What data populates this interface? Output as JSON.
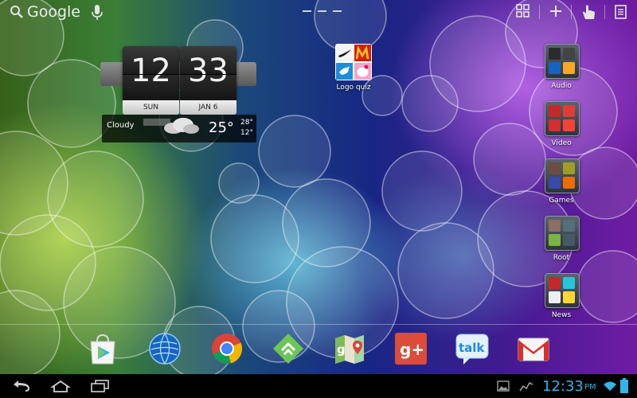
{
  "status_bar": {
    "search_label": "Google",
    "icons": [
      "search-icon",
      "mic-icon",
      "all-apps-icon",
      "add-icon",
      "hand-icon",
      "menu-icon"
    ]
  },
  "clock_widget": {
    "hour": "12",
    "minute": "33",
    "day": "SUN",
    "date": "JAN 6",
    "weather": "Cloudy",
    "temperature": "25°",
    "high": "28°",
    "low": "12°"
  },
  "desktop_apps": [
    {
      "label": "Logo quiz"
    }
  ],
  "folders": [
    {
      "label": "Audio"
    },
    {
      "label": "Video"
    },
    {
      "label": "Games"
    },
    {
      "label": "Root"
    },
    {
      "label": "News"
    }
  ],
  "dock": [
    "play-store-icon",
    "globe-icon",
    "chrome-icon",
    "feedly-icon",
    "maps-icon",
    "google-plus-icon",
    "talk-icon",
    "gmail-icon"
  ],
  "dock_labels": {
    "google_plus": "g+",
    "talk": "talk"
  },
  "nav_bar": {
    "time": "12:33",
    "ampm": "PM",
    "icons": [
      "back-icon",
      "home-icon",
      "recent-apps-icon",
      "gallery-icon",
      "activity-icon",
      "wifi-icon",
      "battery-icon"
    ]
  },
  "colors": {
    "clock_blue": "#33b5e5",
    "nav_background": "#000000"
  }
}
